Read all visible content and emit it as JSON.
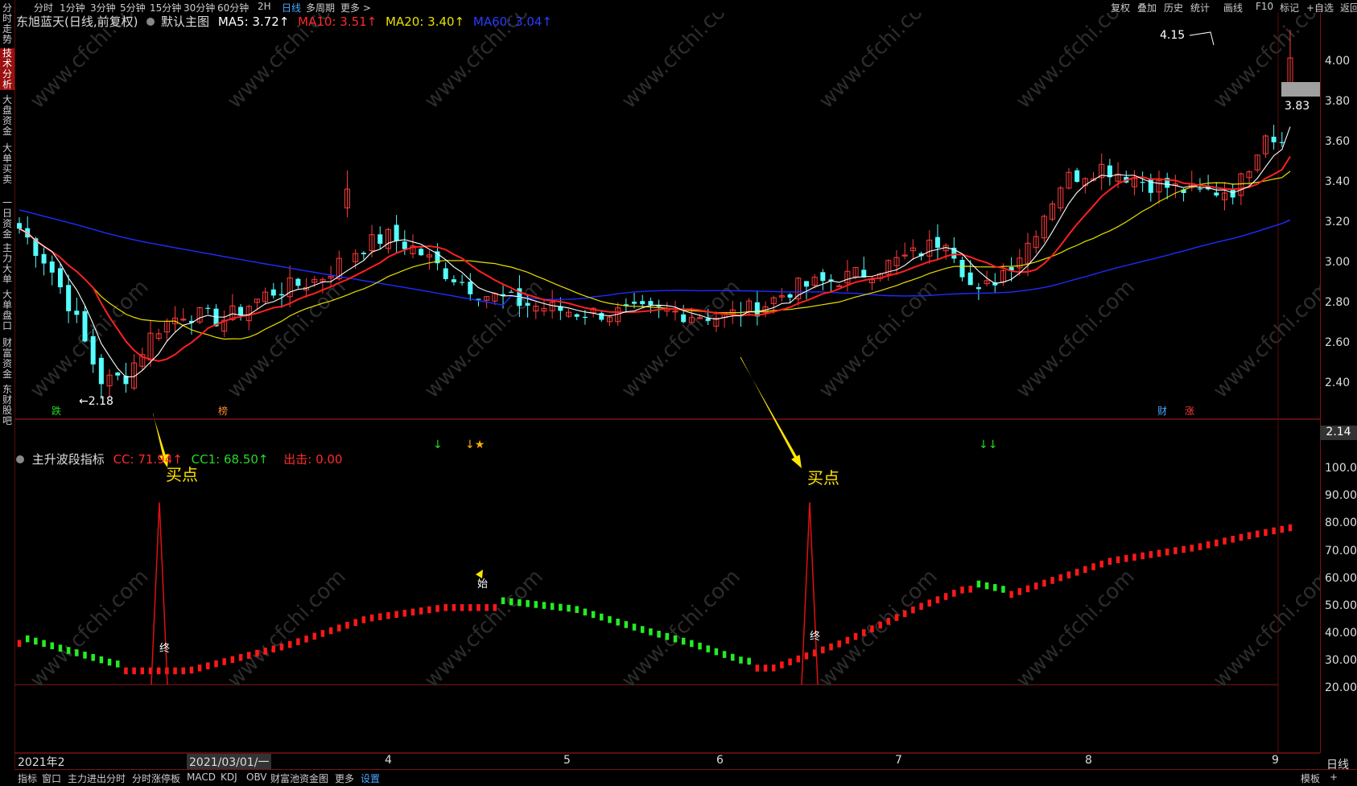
{
  "top_nav": {
    "items": [
      "分时",
      "1分钟",
      "3分钟",
      "5分钟",
      "15分钟",
      "30分钟",
      "60分钟",
      "2H",
      "日线",
      "多周期",
      "更多 >"
    ],
    "active": "日线",
    "right_items": [
      "复权",
      "叠加",
      "历史",
      "统计",
      "画线",
      "F10",
      "标记",
      "+自选",
      "返回"
    ]
  },
  "left_tabs": [
    "分时走势",
    "技术分析",
    "大盘资金",
    "大单买卖",
    "一日资金",
    "主力大单",
    "大单盘口",
    "财富资金",
    "东财股吧"
  ],
  "left_active": "技术分析",
  "main_header": {
    "stock": "东旭蓝天(日线,前复权)",
    "template": "默认主图",
    "ma5": "MA5: 3.72↑",
    "ma10": "MA10: 3.51↑",
    "ma20": "MA20: 3.40↑",
    "ma60": "MA60: 3.04↑"
  },
  "indicator_header": {
    "name": "主升波段指标",
    "cc": "CC: 71.94↑",
    "cc1": "CC1: 68.50↑",
    "chuji": "出击: 0.00"
  },
  "price_axis": [
    "4.00",
    "3.80",
    "3.60",
    "3.40",
    "3.20",
    "3.00",
    "2.80",
    "2.60",
    "2.40"
  ],
  "price_current": "2.14",
  "price_label_2": "3.83",
  "ind_axis": [
    "100.0",
    "90.00",
    "80.00",
    "70.00",
    "60.00",
    "50.00",
    "40.00",
    "30.00",
    "20.00"
  ],
  "markers": {
    "high": "4.15",
    "low": "←2.18",
    "die": "跌",
    "bang": "榜",
    "cai": "财",
    "zhang": "涨",
    "arrow_a": "↓",
    "arrow_b": "↓★",
    "arrow_c": "↓↓"
  },
  "annotations": {
    "buy1": "买点",
    "buy2": "买点",
    "end1": "终",
    "end2": "终",
    "start1": "始"
  },
  "date_axis": [
    "2021年2",
    "2021/03/01/一",
    "4",
    "5",
    "6",
    "7",
    "8",
    "9"
  ],
  "period_label": "日线",
  "bottom_tabs": [
    "指标",
    "窗口",
    "主力进出分时",
    "分时涨停板",
    "MACD",
    "KDJ",
    "OBV",
    "财富池资金图",
    "更多",
    "设置"
  ],
  "bottom_right": [
    "模板",
    "+"
  ],
  "watermark": "www.cfchi.com",
  "colors": {
    "up": "#ff3b3b",
    "down": "#54ffff",
    "ma5": "#ffffff",
    "ma10": "#ff2020",
    "ma20": "#e8e000",
    "ma60": "#1e2cff",
    "accent": "#9a0f0f"
  }
}
